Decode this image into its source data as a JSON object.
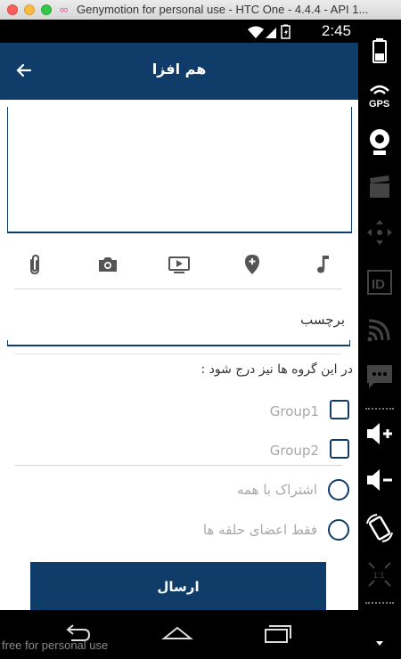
{
  "window": {
    "title": "Genymotion for personal use - HTC One - 4.4.4 - API 1..."
  },
  "statusbar": {
    "time": "2:45"
  },
  "appbar": {
    "title": "هم افزا"
  },
  "attachments": [
    "attach-icon",
    "camera-icon",
    "video-icon",
    "location-pin-icon",
    "music-note-icon"
  ],
  "tag_field": {
    "label": "برچسب"
  },
  "groups": {
    "title": "در این گروه ها نیز درج شود :",
    "items": [
      {
        "label": "Group1",
        "checked": false
      },
      {
        "label": "Group2",
        "checked": false
      }
    ]
  },
  "audience": {
    "options": [
      {
        "label": "اشتراک با همه",
        "selected": false
      },
      {
        "label": "فقط اعضای حلقه ها",
        "selected": false
      }
    ]
  },
  "send_button": {
    "label": "ارسال"
  },
  "footer": {
    "watermark": "free for personal use"
  },
  "colors": {
    "primary": "#0f3c69",
    "muted_text": "#a8a8a8"
  }
}
